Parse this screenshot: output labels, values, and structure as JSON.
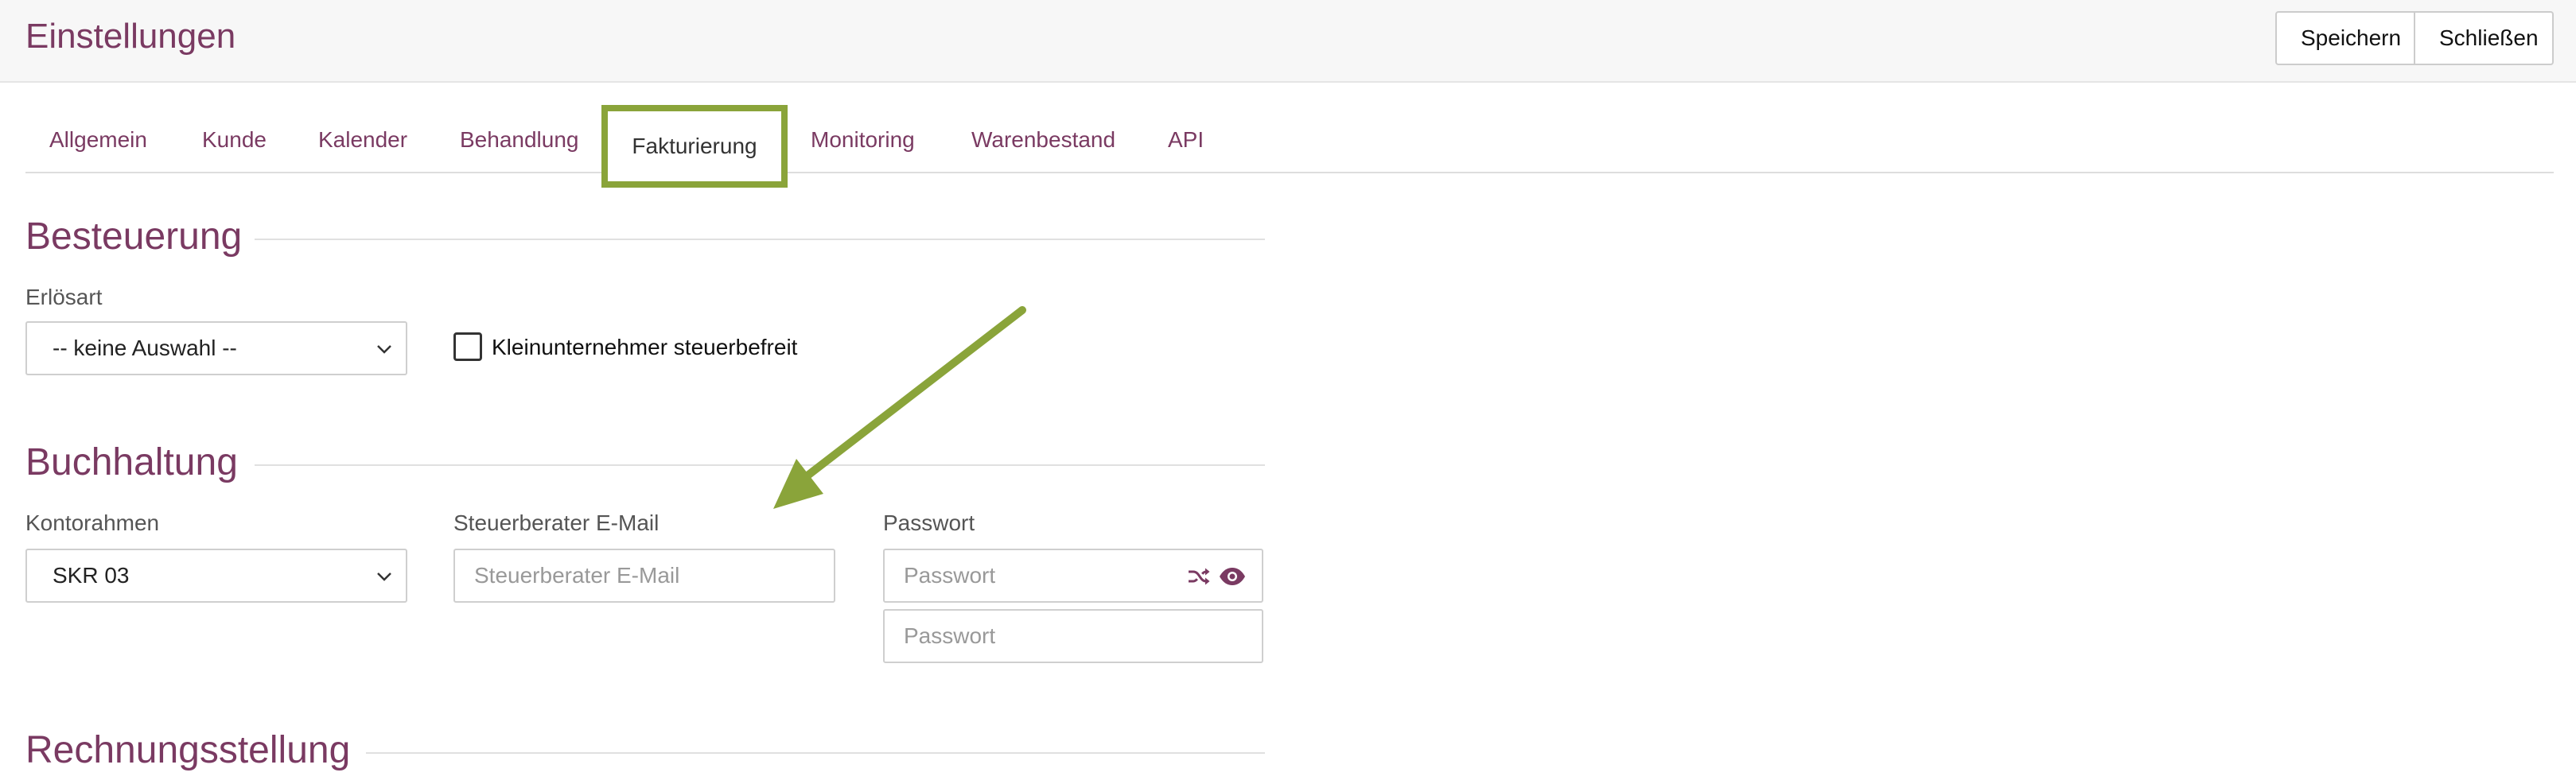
{
  "header": {
    "title": "Einstellungen",
    "save_label": "Speichern",
    "close_label": "Schließen"
  },
  "tabs": [
    {
      "label": "Allgemein"
    },
    {
      "label": "Kunde"
    },
    {
      "label": "Kalender"
    },
    {
      "label": "Behandlung"
    },
    {
      "label": "Fakturierung",
      "active": true
    },
    {
      "label": "Monitoring"
    },
    {
      "label": "Warenbestand"
    },
    {
      "label": "API"
    }
  ],
  "sections": {
    "besteuerung": {
      "title": "Besteuerung",
      "erloesart_label": "Erlösart",
      "erloesart_value": "-- keine Auswahl --",
      "kleinunternehmer_label": "Kleinunternehmer steuerbefreit",
      "kleinunternehmer_checked": false
    },
    "buchhaltung": {
      "title": "Buchhaltung",
      "kontorahmen_label": "Kontorahmen",
      "kontorahmen_value": "SKR 03",
      "email_label": "Steuerberater E-Mail",
      "email_placeholder": "Steuerberater E-Mail",
      "password_label": "Passwort",
      "password_placeholder": "Passwort",
      "password_repeat_placeholder": "Passwort"
    },
    "rechnungsstellung": {
      "title": "Rechnungsstellung"
    }
  },
  "icons": {
    "shuffle": "shuffle-icon",
    "eye": "eye-icon",
    "chevron": "chevron-down-icon"
  },
  "colors": {
    "accent": "#7a3a62",
    "highlight": "#8aa43a"
  }
}
